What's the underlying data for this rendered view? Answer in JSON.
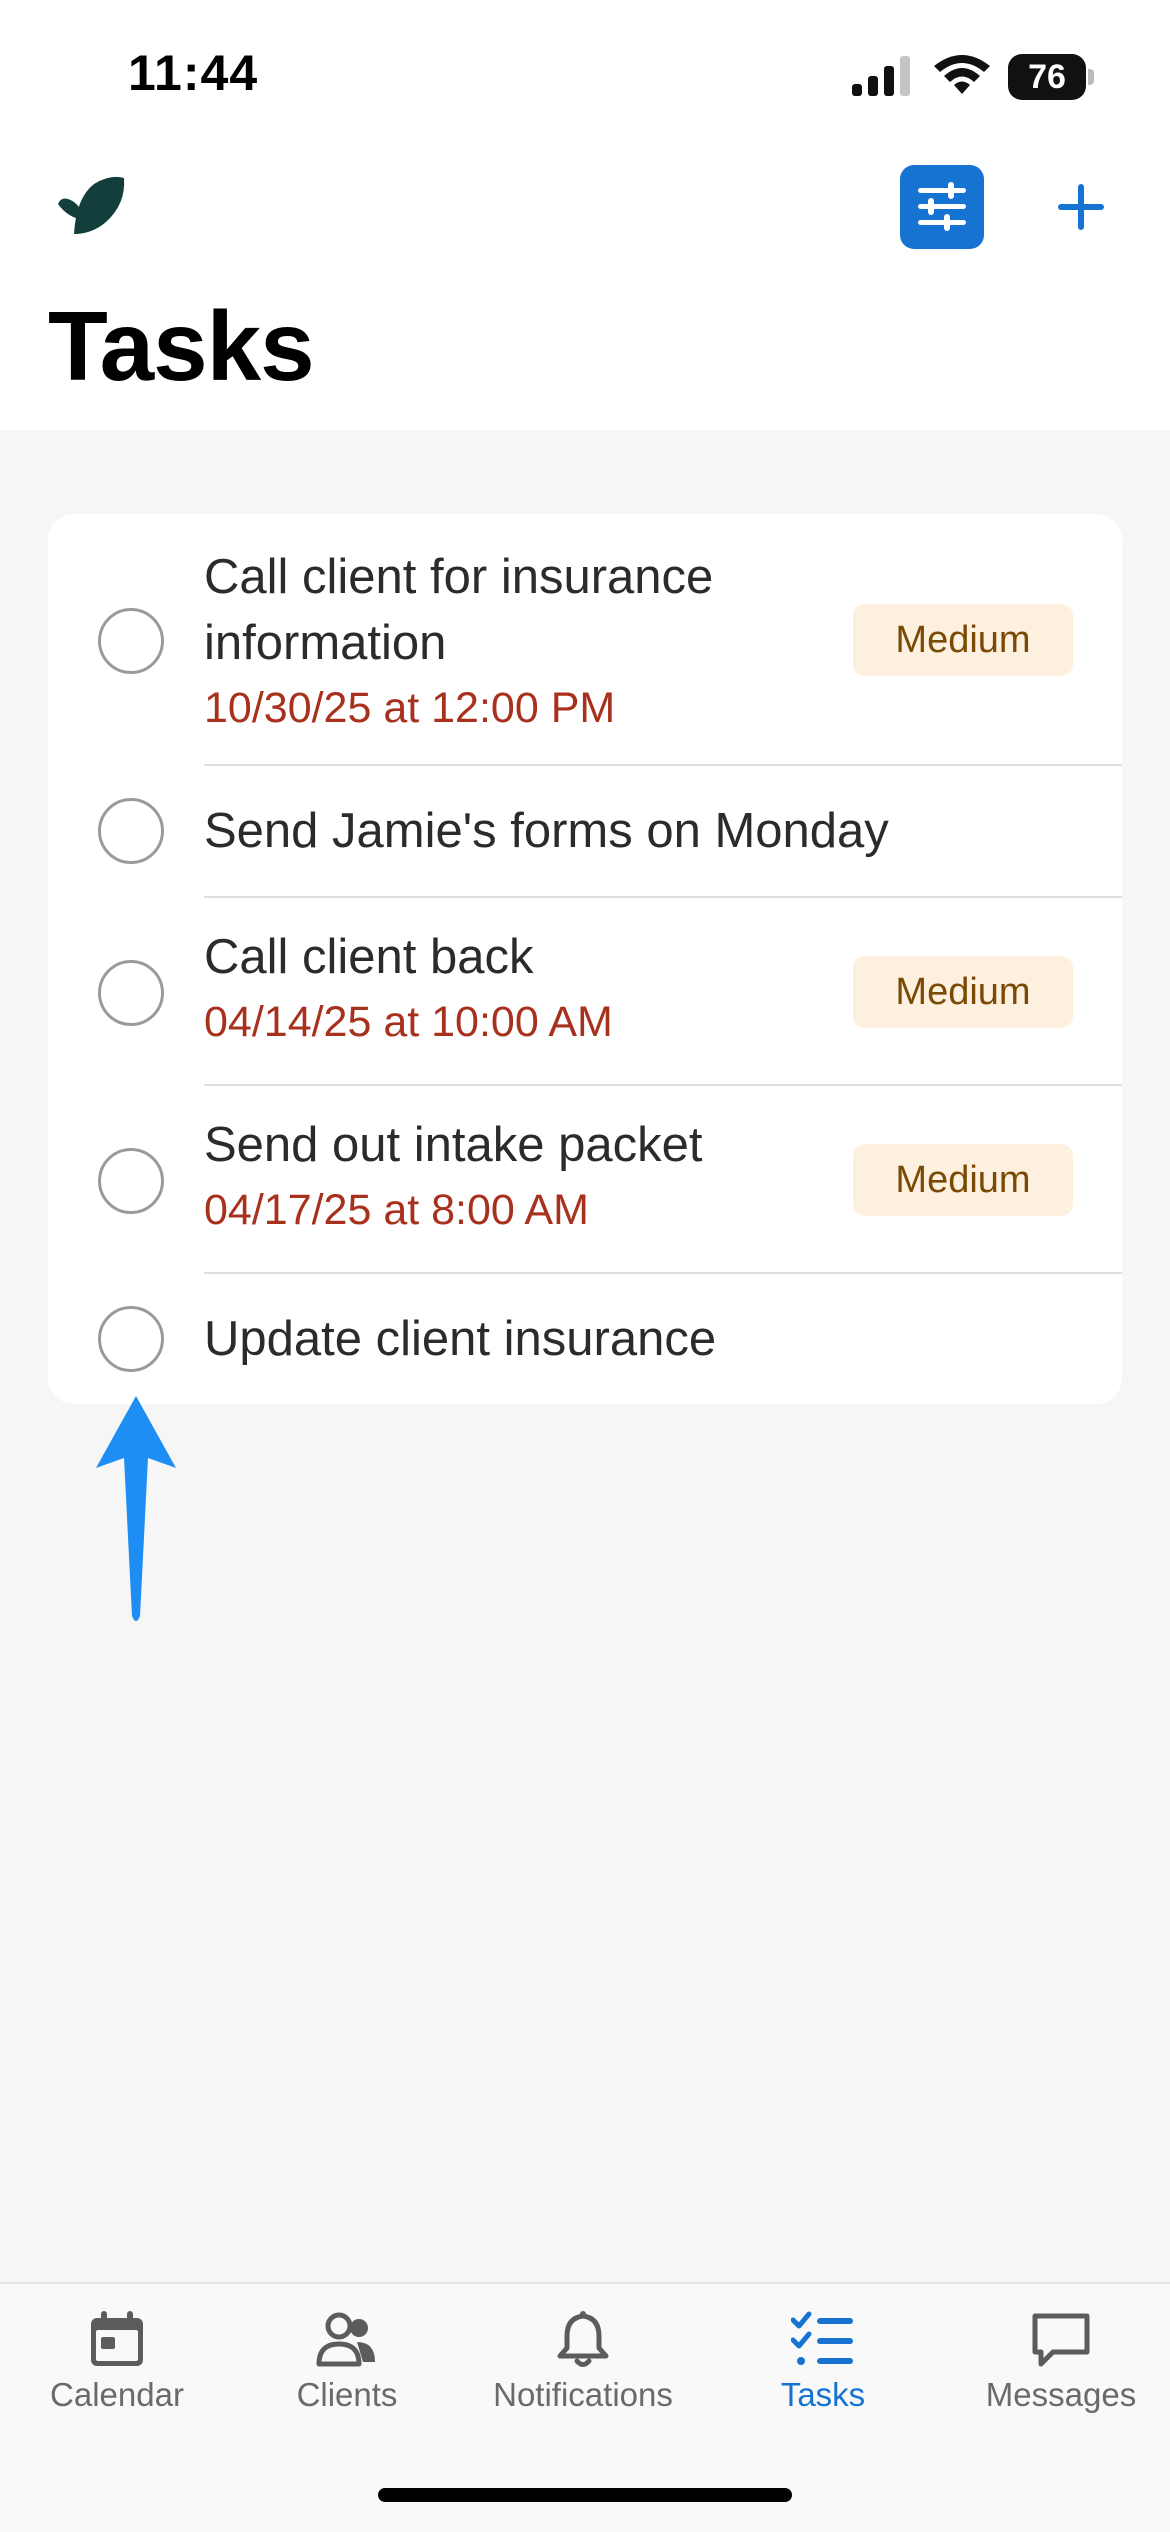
{
  "status_bar": {
    "time": "11:44",
    "battery": "76"
  },
  "header": {
    "title": "Tasks",
    "filter_icon": "sliders-icon",
    "add_icon": "plus-icon"
  },
  "tasks": [
    {
      "title_line1": "Call client for insurance",
      "title_line2": "information",
      "date": "10/30/25 at 12:00 PM",
      "priority": "Medium"
    },
    {
      "title": "Send Jamie's forms on Monday"
    },
    {
      "title": "Call client back",
      "date": "04/14/25 at 10:00 AM",
      "priority": "Medium"
    },
    {
      "title": "Send out intake packet",
      "date": "04/17/25 at 8:00 AM",
      "priority": "Medium"
    },
    {
      "title": "Update client insurance"
    }
  ],
  "tab_bar": {
    "items": [
      {
        "label": "Calendar",
        "icon": "calendar-icon"
      },
      {
        "label": "Clients",
        "icon": "people-icon"
      },
      {
        "label": "Notifications",
        "icon": "bell-icon"
      },
      {
        "label": "Tasks",
        "icon": "checklist-icon",
        "active": true
      },
      {
        "label": "Messages",
        "icon": "chat-bubble-icon"
      }
    ]
  },
  "colors": {
    "accent": "#1673d1",
    "date_text": "#a8311d",
    "badge_bg": "#fdf0de",
    "badge_text": "#7a4a05",
    "annotation_arrow": "#1e8ef5"
  }
}
